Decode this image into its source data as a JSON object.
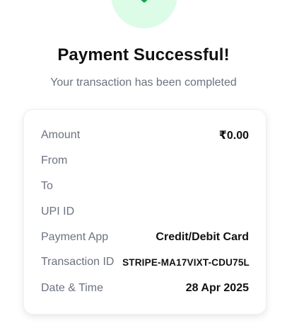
{
  "header": {
    "title": "Payment Successful!",
    "subtitle": "Your transaction has been completed"
  },
  "details": {
    "rows": [
      {
        "label": "Amount",
        "value": "₹0.00"
      },
      {
        "label": "From",
        "value": ""
      },
      {
        "label": "To",
        "value": ""
      },
      {
        "label": "UPI ID",
        "value": ""
      },
      {
        "label": "Payment App",
        "value": "Credit/Debit Card"
      },
      {
        "label": "Transaction ID",
        "value": "STRIPE-MA17VIXT-CDU75L"
      },
      {
        "label": "Date & Time",
        "value": "28 Apr 2025"
      }
    ]
  },
  "colors": {
    "success_bg": "#dcfce7",
    "success_icon": "#16a34a"
  },
  "icons": {
    "status": "check-icon"
  }
}
